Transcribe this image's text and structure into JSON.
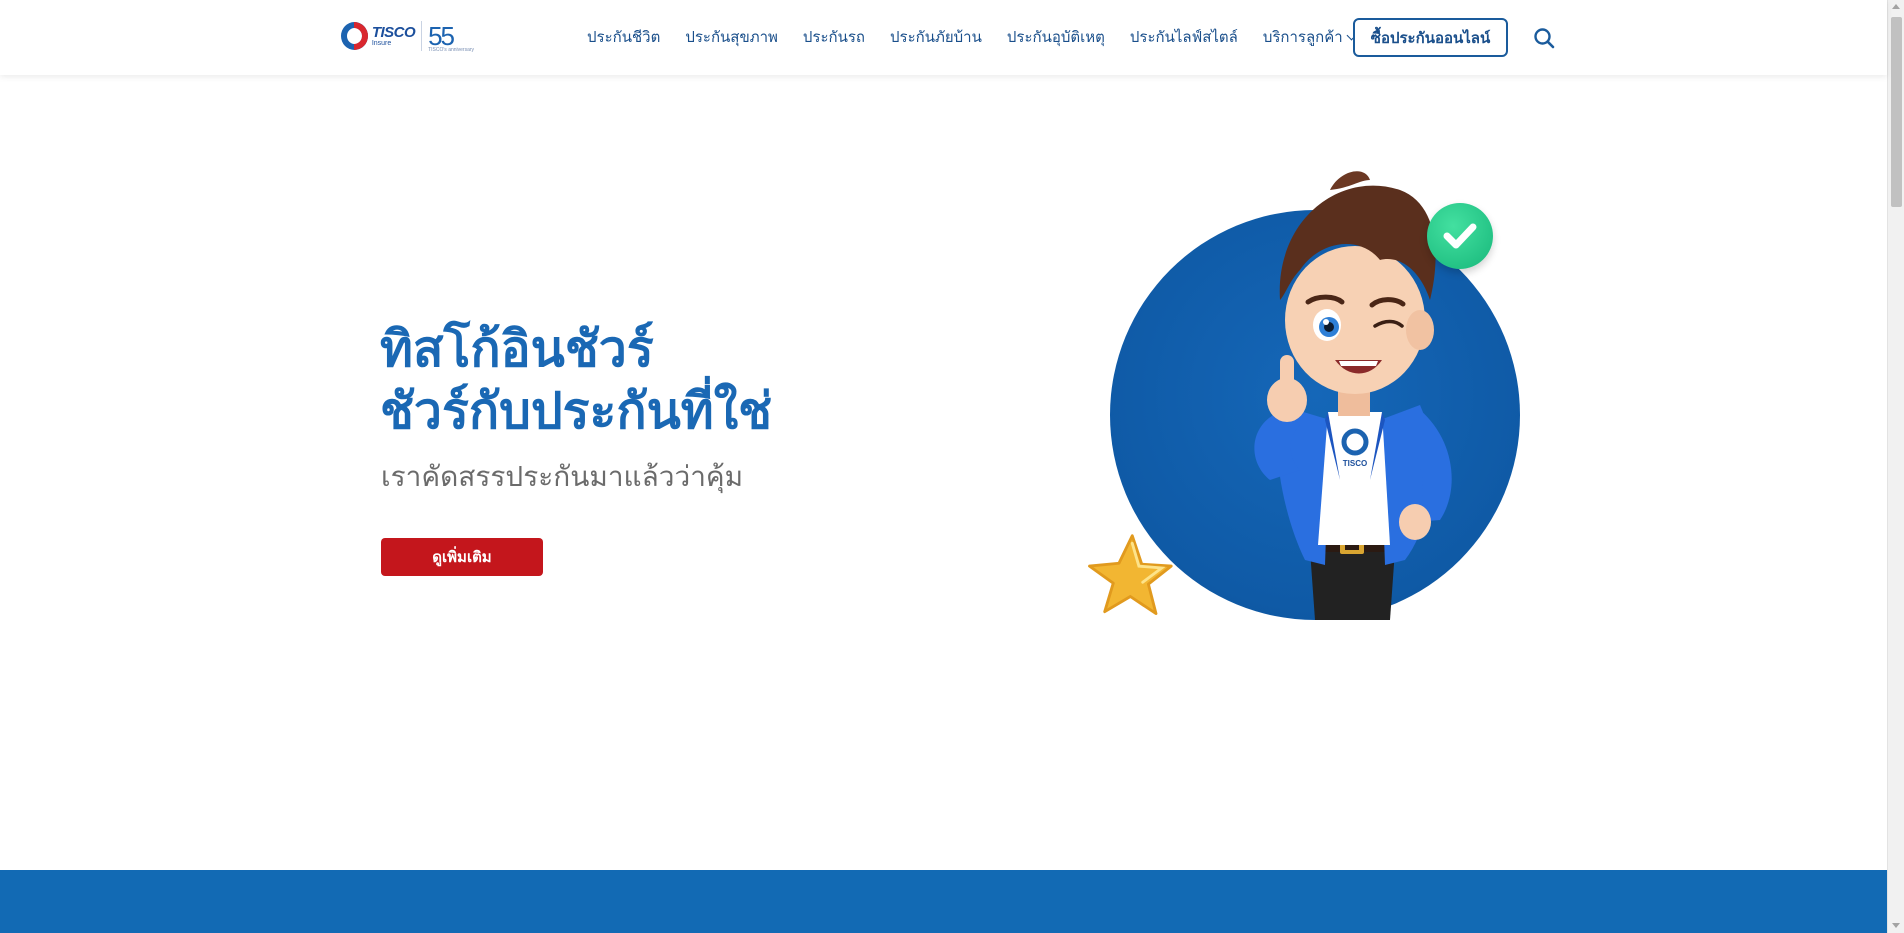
{
  "header": {
    "logo": {
      "brand": "TISCO",
      "sub": "Insure",
      "anniversary": "55",
      "anniversary_caption": "TISCO's anniversary"
    },
    "nav": [
      {
        "label": "ประกันชีวิต"
      },
      {
        "label": "ประกันสุขภาพ"
      },
      {
        "label": "ประกันรถ"
      },
      {
        "label": "ประกันภัยบ้าน"
      },
      {
        "label": "ประกันอุบัติเหตุ"
      },
      {
        "label": "ประกันไลฟ์สไตล์"
      },
      {
        "label": "บริการลูกค้า",
        "has_dropdown": true
      }
    ],
    "buy_button": "ซื้อประกันออนไลน์",
    "search_icon": "search-icon"
  },
  "hero": {
    "title_line1": "ทิสโก้อินชัวร์",
    "title_line2": "ชัวร์กับประกันที่ใช่",
    "subtitle": "เราคัดสรรประกันมาแล้วว่าคุ้ม",
    "cta": "ดูเพิ่มเติม",
    "mascot_shirt_logo": "TISCO"
  },
  "colors": {
    "primary": "#1a68b4",
    "nav_text": "#1a4f8b",
    "cta": "#c4161c",
    "band": "#126ab4",
    "circle": "#0f5aa6",
    "check": "#17b77a",
    "star": "#f2b632"
  }
}
